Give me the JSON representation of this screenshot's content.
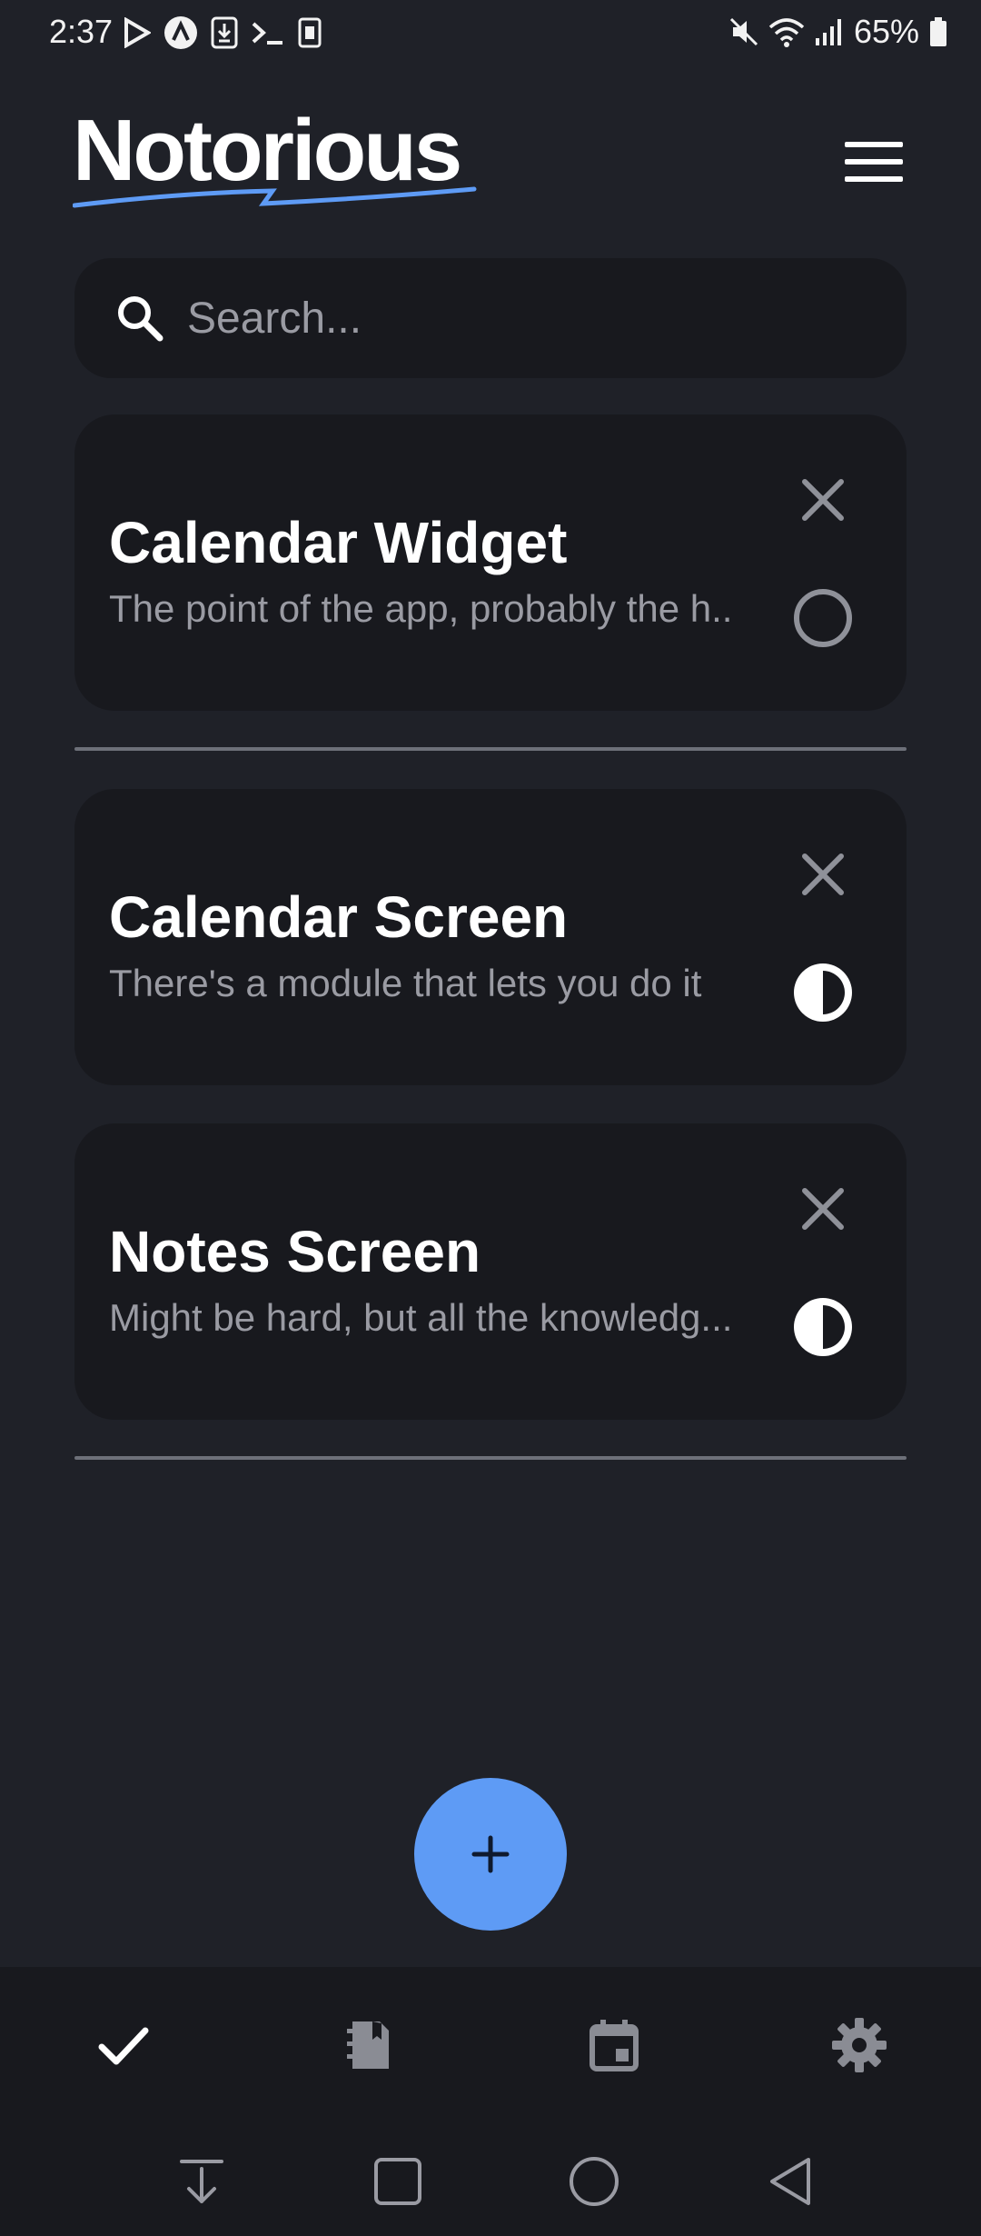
{
  "status_bar": {
    "time": "2:37",
    "battery": "65%",
    "notification_icons": [
      "play-store-icon",
      "app-icon",
      "download-icon",
      "terminal-icon",
      "sim-icon"
    ],
    "system_icons": [
      "mute-icon",
      "wifi-icon",
      "signal-icon",
      "battery-icon"
    ]
  },
  "header": {
    "app_title": "Notorious",
    "menu_icon": "hamburger-menu-icon"
  },
  "search": {
    "placeholder": "Search...",
    "value": "",
    "icon": "search-icon"
  },
  "tasks": [
    {
      "title": "Calendar Widget",
      "description": "The point of the app, probably the h..",
      "status": "not-started"
    },
    {
      "title": "Calendar Screen",
      "description": "There's a module that lets you do it",
      "status": "in-progress"
    },
    {
      "title": "Notes Screen",
      "description": "Might be hard, but all the knowledg...",
      "status": "in-progress"
    }
  ],
  "fab": {
    "icon": "plus-icon"
  },
  "bottom_nav": [
    {
      "icon": "checkmark-icon",
      "active": true
    },
    {
      "icon": "notebook-icon",
      "active": false
    },
    {
      "icon": "calendar-icon",
      "active": false
    },
    {
      "icon": "gear-icon",
      "active": false
    }
  ],
  "colors": {
    "background": "#1f2128",
    "card": "#18191e",
    "accent": "#5e9bf5",
    "muted_text": "#9a9ba3"
  }
}
